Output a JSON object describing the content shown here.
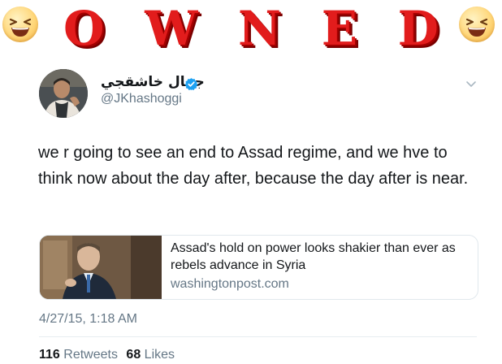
{
  "banner": {
    "letters": [
      "O",
      "W",
      "N",
      "E",
      "D"
    ],
    "left_emoji": "laughing-face-icon",
    "right_emoji": "laughing-face-icon"
  },
  "tweet": {
    "display_name": "جمال خاشقجي",
    "handle": "@JKhashoggi",
    "verified_icon": "verified-badge-icon",
    "menu_icon": "chevron-down-icon",
    "text": "we r going to see an end to Assad regime, and we hve to think now about the day after, because the day after is near.",
    "timestamp": "4/27/15, 1:18 AM",
    "retweets_count": "116",
    "retweets_label": "Retweets",
    "likes_count": "68",
    "likes_label": "Likes"
  },
  "card": {
    "title": "Assad's hold on power looks shakier than ever as rebels advance in Syria",
    "domain": "washingtonpost.com"
  },
  "colors": {
    "banner_red": "#e21c1c",
    "verified_blue": "#1da1f2",
    "secondary_text": "#657786",
    "primary_text": "#14171a"
  }
}
